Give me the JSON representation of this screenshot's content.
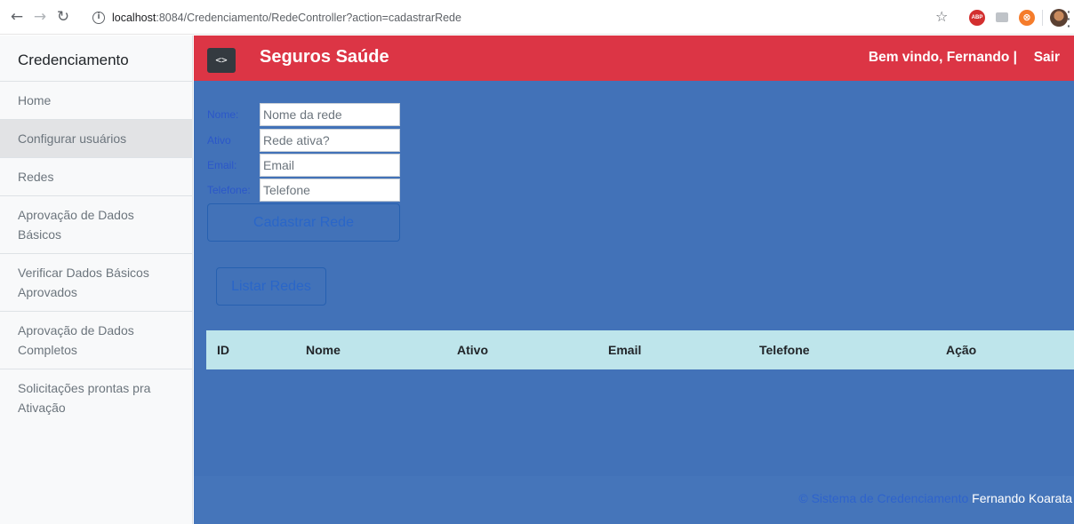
{
  "browser": {
    "url_host": "localhost",
    "url_rest": ":8084/Credenciamento/RedeController?action=cadastrarRede"
  },
  "sidebar": {
    "heading": "Credenciamento",
    "items": [
      {
        "label": "Home"
      },
      {
        "label": "Configurar usuários"
      },
      {
        "label": "Redes"
      },
      {
        "label": "Aprovação de Dados Básicos"
      },
      {
        "label": "Verificar Dados Básicos Aprovados"
      },
      {
        "label": "Aprovação de Dados Completos"
      },
      {
        "label": "Solicitações prontas pra Ativação"
      }
    ]
  },
  "navbar": {
    "toggle_label": "<>",
    "brand": "Seguros Saúde",
    "welcome": "Bem vindo, Fernando |",
    "logout": "Sair",
    "color": "#dc3545"
  },
  "form": {
    "nome_label": "Nome:",
    "nome_placeholder": "Nome da rede",
    "ativo_label": "Ativo",
    "ativo_placeholder": "Rede ativa?",
    "email_label": "Email:",
    "email_placeholder": "Email",
    "telefone_label": "Telefone:",
    "telefone_placeholder": "Telefone",
    "submit_label": "Cadastrar Rede"
  },
  "list_button": "Listar Redes",
  "table": {
    "headers": [
      "ID",
      "Nome",
      "Ativo",
      "Email",
      "Telefone",
      "Ação"
    ],
    "rows": []
  },
  "footer": {
    "system": "© Sistema de Credenciamento",
    "author": "Fernando Koarata"
  },
  "colors": {
    "main_bg": "#4272b8",
    "table_header_bg": "#bee5eb"
  }
}
